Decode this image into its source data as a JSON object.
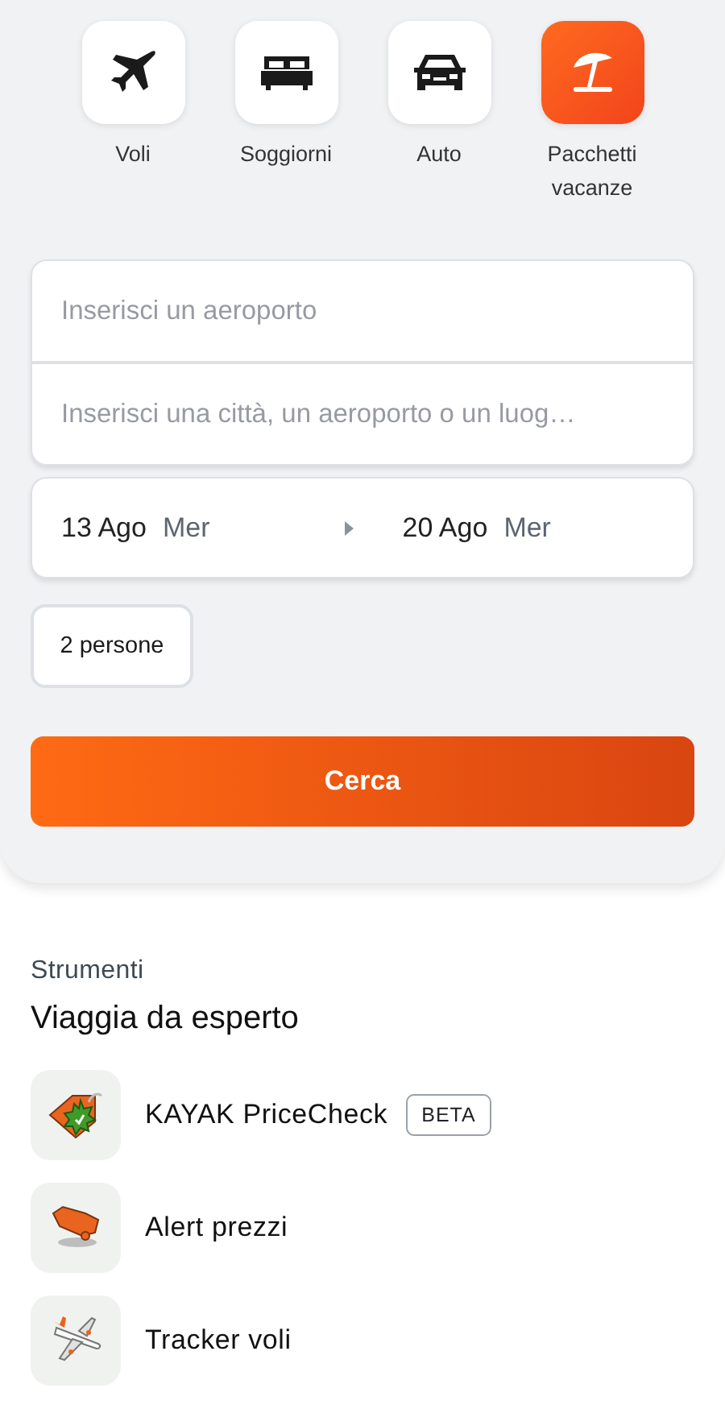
{
  "categories": [
    {
      "kind": "plane",
      "label": "Voli",
      "selected": false
    },
    {
      "kind": "bed",
      "label": "Soggiorni",
      "selected": false
    },
    {
      "kind": "car",
      "label": "Auto",
      "selected": false
    },
    {
      "kind": "beach",
      "label": "Pacchetti vacanze",
      "selected": true
    }
  ],
  "search_form": {
    "origin": {
      "placeholder": "Inserisci un aeroporto"
    },
    "destination": {
      "placeholder": "Inserisci una città, un aeroporto o un luog…"
    },
    "start_date": {
      "date": "13 Ago",
      "weekday": "Mer"
    },
    "end_date": {
      "date": "20 Ago",
      "weekday": "Mer"
    },
    "travelers": "2 persone",
    "search_button": "Cerca"
  },
  "tools": {
    "section_label": "Strumenti",
    "heading": "Viaggia da esperto",
    "items": [
      {
        "kind": "pricecheck",
        "label": "KAYAK PriceCheck",
        "badge": "BETA"
      },
      {
        "kind": "alert",
        "label": "Alert prezzi"
      },
      {
        "kind": "tracker",
        "label": "Tracker voli"
      }
    ]
  }
}
